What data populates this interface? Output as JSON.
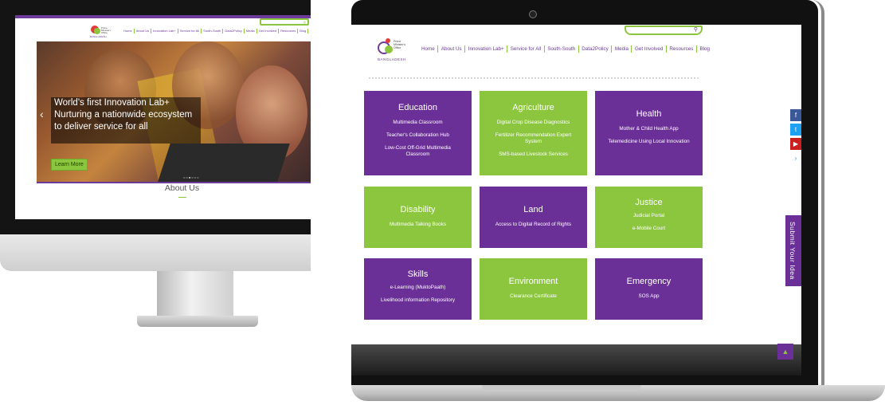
{
  "desktop": {
    "nav": [
      "Home",
      "About Us",
      "Innovation Lab+",
      "Service for All",
      "South-South",
      "Data2Policy",
      "Media",
      "Get Involved",
      "Resources",
      "Blog"
    ],
    "hero": {
      "line1": "World's first Innovation Lab+",
      "line2": "Nurturing a nationwide ecosystem",
      "line3": "to deliver service for all",
      "button": "Learn More",
      "prev_arrow": "‹",
      "dots": "○○●○○○"
    },
    "section_title": "About Us",
    "search_icon": "⚲"
  },
  "laptop": {
    "logo": {
      "brand": "BANGLADESH",
      "pmo": "Prime Minister's Office"
    },
    "nav": [
      "Home",
      "About Us",
      "Innovation Lab+",
      "Service for All",
      "South-South",
      "Data2Policy",
      "Media",
      "Get Involved",
      "Resources",
      "Blog"
    ],
    "search_icon": "⚲",
    "tiles": [
      {
        "title": "Education",
        "items": [
          "Multimedia Classroom",
          "Teacher's Collaboration Hub",
          "Low-Cost Off-Grid Multimedia Classroom"
        ]
      },
      {
        "title": "Agriculture",
        "items": [
          "Digital Crop Disease Diagnostics",
          "Fertilizer Recommendation Expert System",
          "SMS-based Livestock Services"
        ]
      },
      {
        "title": "Health",
        "items": [
          "Mother & Child Health App",
          "Telemedicine Using Local Innovation"
        ]
      },
      {
        "title": "Disability",
        "items": [
          "Multimedia Talking Books"
        ]
      },
      {
        "title": "Land",
        "items": [
          "Access to Digital Record of Rights"
        ]
      },
      {
        "title": "Justice",
        "items": [
          "Judicial Portal",
          "e-Mobile Court"
        ]
      },
      {
        "title": "Skills",
        "items": [
          "e-Learning (MuktoPaath)",
          "Livelihood information Repository"
        ]
      },
      {
        "title": "Environment",
        "items": [
          "Clearance Certificate"
        ]
      },
      {
        "title": "Emergency",
        "items": [
          "SOS App"
        ]
      }
    ],
    "social": {
      "facebook": "f",
      "twitter": "t",
      "youtube": "▶",
      "more": "›"
    },
    "submit_label": "Submit Your Idea",
    "back_to_top": "▲",
    "colors": {
      "purple": "#6b2f98",
      "green": "#8cc63f"
    }
  }
}
